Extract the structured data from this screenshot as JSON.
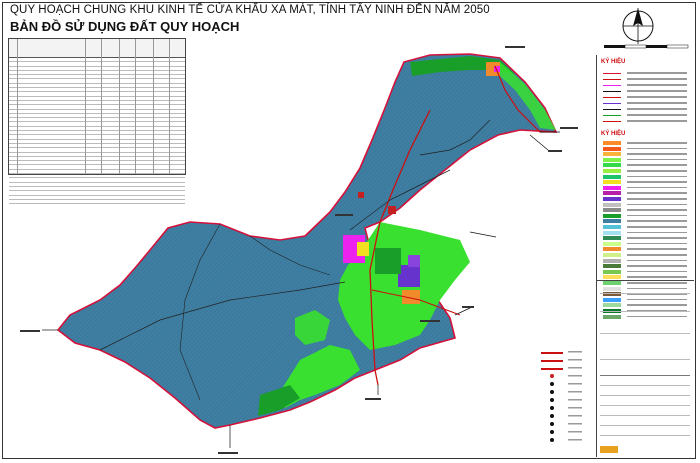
{
  "header": {
    "title": "QUY HOẠCH CHUNG KHU KINH TẾ CỬA KHẨU XA MÁT, TỈNH TÂY NINH ĐẾN NĂM 2050",
    "subtitle": "BẢN ĐỒ SỬ DỤNG ĐẤT QUY HOẠCH"
  },
  "legend": {
    "title": "KÝ HIỆU",
    "subtitle": "KÝ HIỆU"
  },
  "colors": {
    "region_fill": "#3e7fa3",
    "hatch": "#555555",
    "green": "#39e02f",
    "dark_green": "#1a9e2a",
    "magenta": "#ee22ee",
    "purple": "#6633cc",
    "orange": "#f08a2a",
    "yellow": "#f2e020",
    "road_red": "#cc1010",
    "boundary": "#d7103a"
  },
  "legend_swatches": [
    "#ff8a2a",
    "#f45a1a",
    "#f9b23a",
    "#7ef04a",
    "#32d94a",
    "#99ee44",
    "#1ec26a",
    "#f2e020",
    "#ee22ee",
    "#b91ea8",
    "#6633cc",
    "#c0c0c0",
    "#8a8a8a",
    "#1a9e2a",
    "#3e7fa3",
    "#55c0d8",
    "#a0e0f0",
    "#2e8b57",
    "#caff8a",
    "#f08a2a",
    "#d0f08a",
    "#b0b0b0",
    "#4a7a3a",
    "#78c850",
    "#ffde5a",
    "#6fd06f",
    "#e0e0e0",
    "#7a5a3a",
    "#3aa0ff",
    "#9ed99e",
    "#0a7a2a",
    "#6aa86a"
  ]
}
